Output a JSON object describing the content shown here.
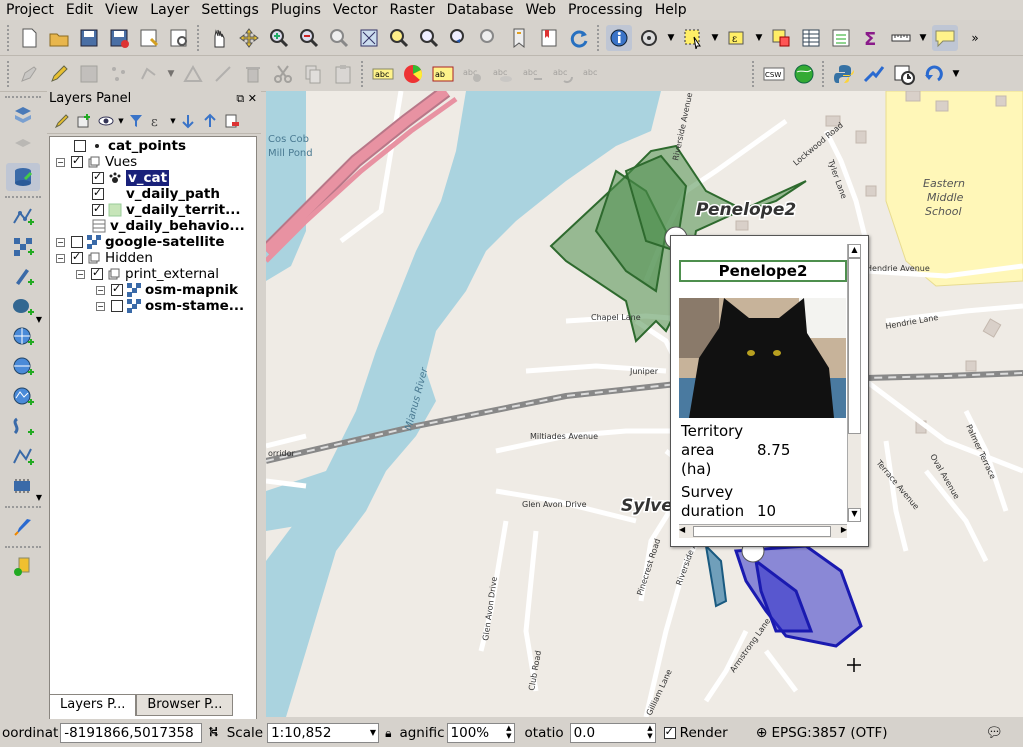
{
  "menu": [
    "Project",
    "Edit",
    "View",
    "Layer",
    "Settings",
    "Plugins",
    "Vector",
    "Raster",
    "Database",
    "Web",
    "Processing",
    "Help"
  ],
  "layers_panel": {
    "title": "Layers Panel",
    "tabs": [
      "Layers P...",
      "Browser P..."
    ],
    "tree": [
      {
        "label": "cat_points",
        "bold": true,
        "checked": false,
        "indent": 0
      },
      {
        "label": "Vues",
        "bold": false,
        "checked": true,
        "indent": 0,
        "group": true
      },
      {
        "label": "v_cat",
        "bold": true,
        "checked": true,
        "indent": 1,
        "selected": true
      },
      {
        "label": "v_daily_path",
        "bold": true,
        "checked": true,
        "indent": 1
      },
      {
        "label": "v_daily_territ...",
        "bold": true,
        "checked": true,
        "indent": 1
      },
      {
        "label": "v_daily_behavio...",
        "bold": true,
        "indent": 1
      },
      {
        "label": "google-satellite",
        "bold": true,
        "checked": false,
        "indent": 0
      },
      {
        "label": "Hidden",
        "bold": false,
        "checked": true,
        "indent": 0,
        "group": true
      },
      {
        "label": "print_external",
        "bold": false,
        "checked": true,
        "indent": 1,
        "group": true
      },
      {
        "label": "osm-mapnik",
        "bold": true,
        "checked": true,
        "indent": 2
      },
      {
        "label": "osm-stame...",
        "bold": true,
        "checked": false,
        "indent": 2
      }
    ]
  },
  "map": {
    "labels": {
      "cos_cob": "Cos Cob",
      "mill_pond": "Mill Pond",
      "eastern": "Eastern",
      "middle": "Middle",
      "school": "School",
      "river": "Mianus River",
      "penelope2": "Penelope2",
      "sylv": "Sylve",
      "lockwood": "Lockwood Road",
      "tyler": "Tyler Lane",
      "riverside": "Riverside Avenue",
      "chapel": "Chapel Lane",
      "juniper": "Juniper",
      "miltiades": "Miltiades Avenue",
      "glen_avon": "Glen Avon Drive",
      "glen_avon2": "Glen Avon Drive",
      "club": "Club Road",
      "hendrie": "Hendrie Avenue",
      "hendrie2": "Hendrie Lane",
      "palmer": "Palmer Terrace",
      "oval": "Oval Avenue",
      "terrace": "Terrace Avenue",
      "pinecrest": "Pinecrest Road",
      "armstrong": "Armstrong Lane",
      "gilliam": "Gilliam Lane",
      "corridor": "orridor",
      "riverside2": "Riverside Avenue"
    },
    "popup": {
      "title": "Penelope2",
      "rows": [
        {
          "k1": "Territory",
          "k2": "area",
          "k3": "(ha)",
          "v": "8.75"
        },
        {
          "k1": "Survey",
          "k2": "duration",
          "v": "10"
        }
      ]
    }
  },
  "status": {
    "coord_label": "oordinat",
    "coord_value": "-8191866,5017358",
    "scale_label": "Scale",
    "scale_value": "1:10,852",
    "magnifier_label": "agnific",
    "magnifier_value": "100%",
    "rotation_label": "otatio",
    "rotation_value": "0.0",
    "render_label": "Render",
    "crs": "EPSG:3857 (OTF)"
  },
  "colors": {
    "green_poly": "#4e8f4e",
    "blue_poly": "#2525c8",
    "water": "#aad3df",
    "highway": "#e892a2"
  }
}
